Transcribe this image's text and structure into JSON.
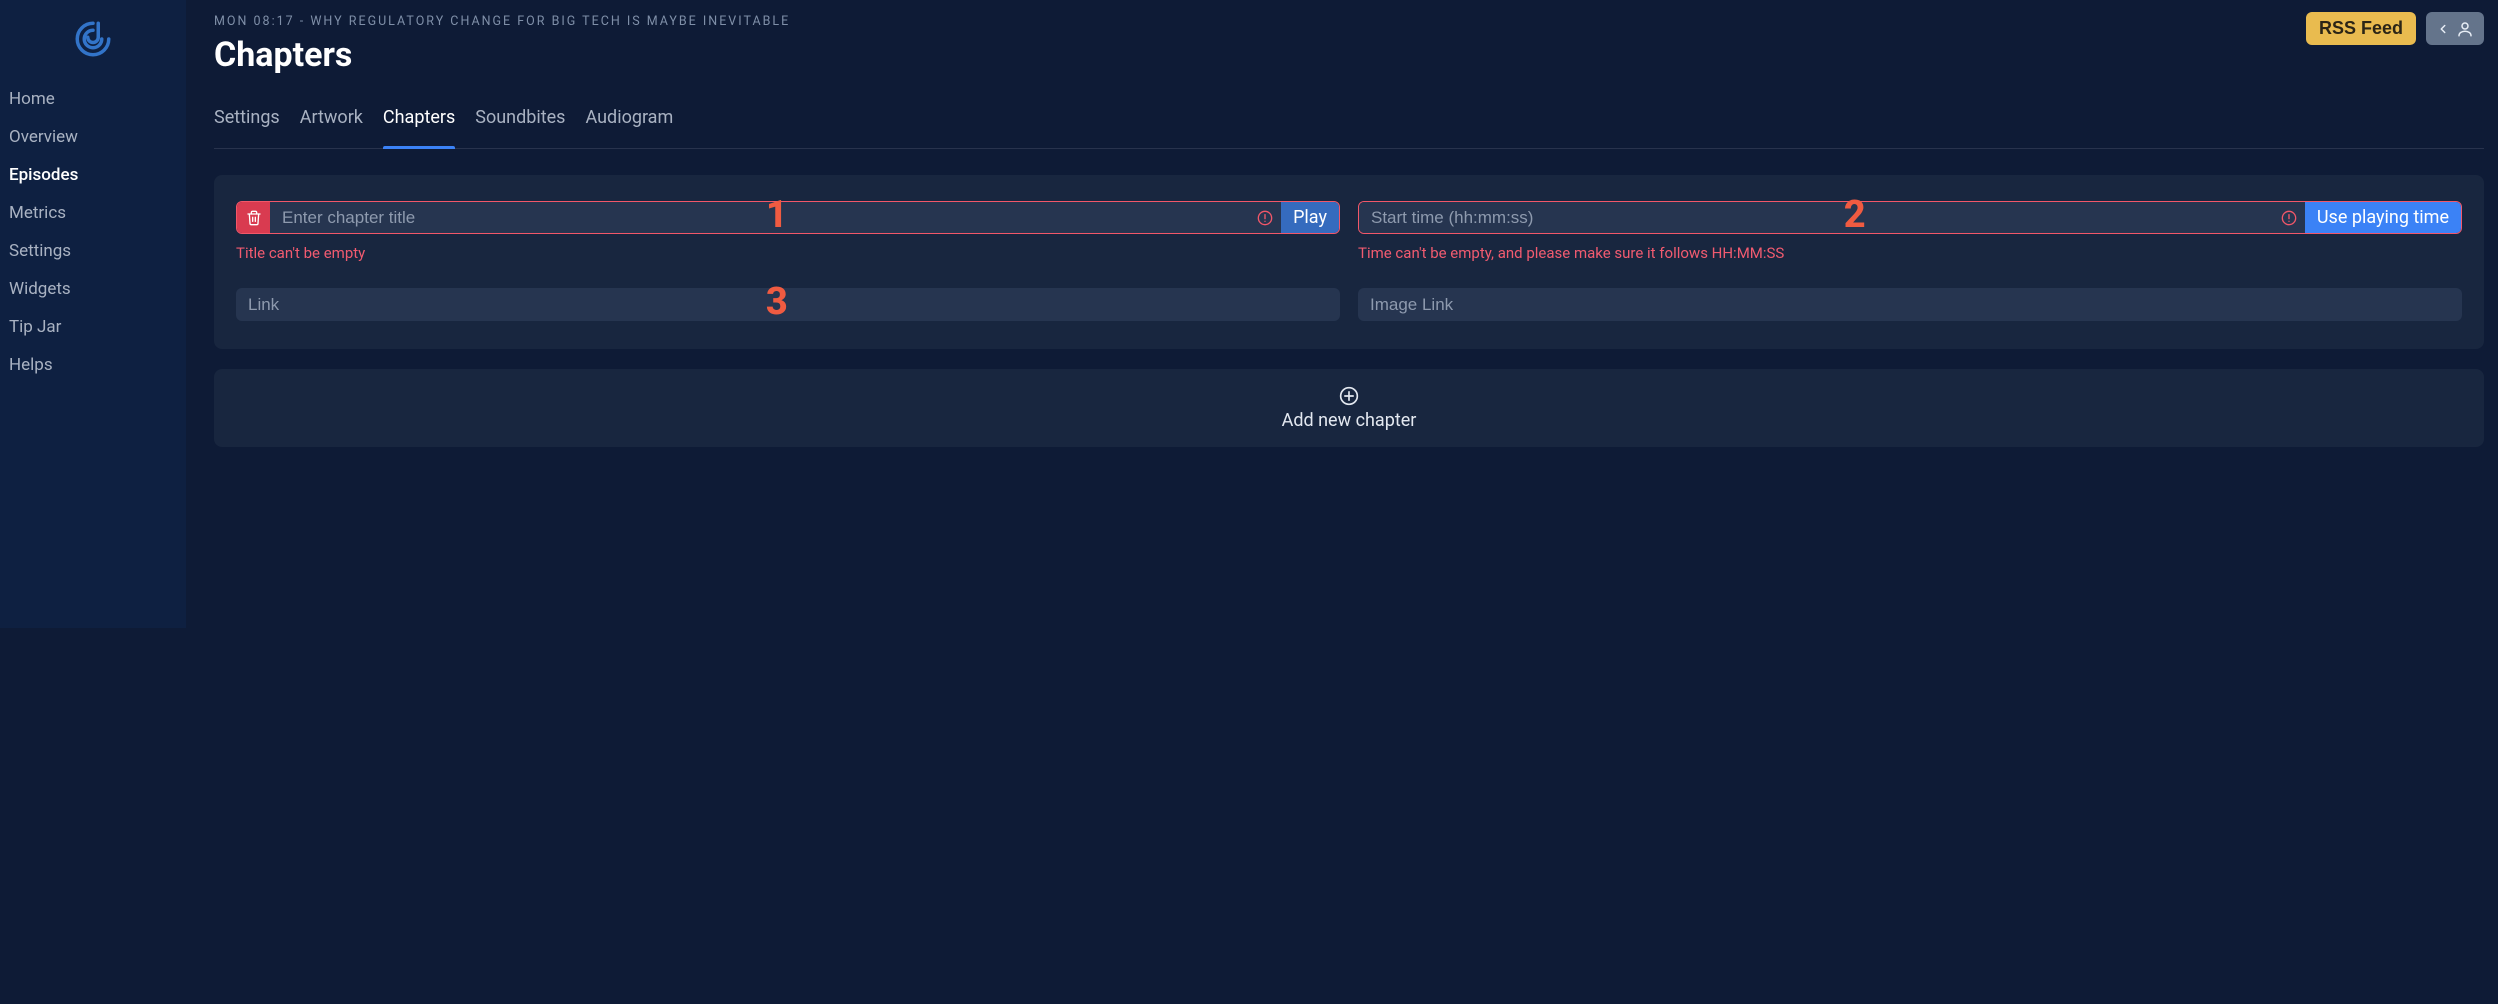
{
  "sidebar": {
    "items": [
      {
        "label": "Home",
        "id": "home",
        "active": false
      },
      {
        "label": "Overview",
        "id": "overview",
        "active": false
      },
      {
        "label": "Episodes",
        "id": "episodes",
        "active": true
      },
      {
        "label": "Metrics",
        "id": "metrics",
        "active": false
      },
      {
        "label": "Settings",
        "id": "settings",
        "active": false
      },
      {
        "label": "Widgets",
        "id": "widgets",
        "active": false
      },
      {
        "label": "Tip Jar",
        "id": "tip-jar",
        "active": false
      },
      {
        "label": "Helps",
        "id": "helps",
        "active": false
      }
    ]
  },
  "header": {
    "breadcrumb": "MON 08:17 - WHY REGULATORY CHANGE FOR BIG TECH IS MAYBE INEVITABLE",
    "title": "Chapters",
    "rss_label": "RSS Feed"
  },
  "tabs": [
    {
      "label": "Settings",
      "id": "settings",
      "active": false
    },
    {
      "label": "Artwork",
      "id": "artwork",
      "active": false
    },
    {
      "label": "Chapters",
      "id": "chapters",
      "active": true
    },
    {
      "label": "Soundbites",
      "id": "soundbites",
      "active": false
    },
    {
      "label": "Audiogram",
      "id": "audiogram",
      "active": false
    }
  ],
  "chapter": {
    "title_placeholder": "Enter chapter title",
    "title_value": "",
    "play_label": "Play",
    "title_error": "Title can't be empty",
    "time_placeholder": "Start time (hh:mm:ss)",
    "time_value": "",
    "use_time_label": "Use playing time",
    "time_error": "Time can't be empty, and please make sure it follows HH:MM:SS",
    "link_placeholder": "Link",
    "link_value": "",
    "image_link_placeholder": "Image Link",
    "image_link_value": ""
  },
  "add_chapter_label": "Add new chapter",
  "callouts": {
    "one": "1",
    "two": "2",
    "three": "3"
  }
}
